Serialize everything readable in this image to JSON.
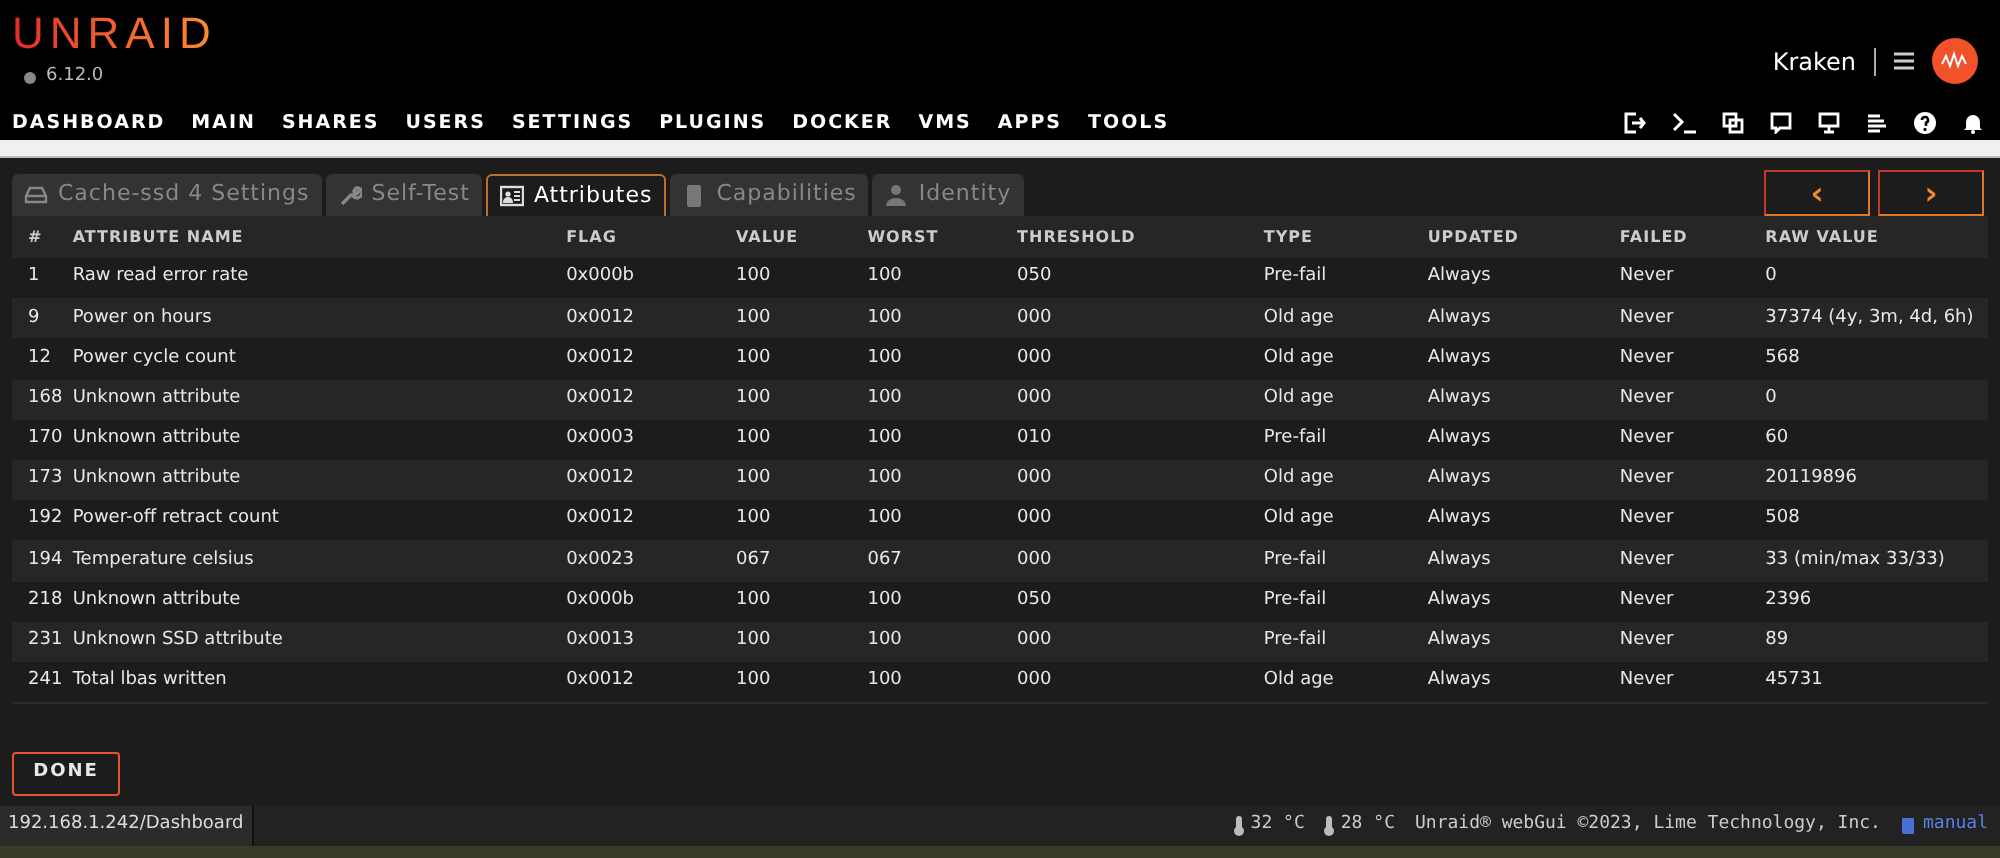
{
  "logo": "UNRAID",
  "version": "6.12.0",
  "server_name": "Kraken",
  "nav": [
    "DASHBOARD",
    "MAIN",
    "SHARES",
    "USERS",
    "SETTINGS",
    "PLUGINS",
    "DOCKER",
    "VMS",
    "APPS",
    "TOOLS"
  ],
  "tabs": [
    {
      "label": "Cache-ssd 4 Settings",
      "selected": false
    },
    {
      "label": "Self-Test",
      "selected": false
    },
    {
      "label": "Attributes",
      "selected": true
    },
    {
      "label": "Capabilities",
      "selected": false
    },
    {
      "label": "Identity",
      "selected": false
    }
  ],
  "pager": [
    "‹",
    "›"
  ],
  "table": {
    "columns": [
      "#",
      "ATTRIBUTE NAME",
      "FLAG",
      "VALUE",
      "WORST",
      "THRESHOLD",
      "TYPE",
      "UPDATED",
      "FAILED",
      "RAW VALUE"
    ],
    "rows": [
      [
        "1",
        "Raw read error rate",
        "0x000b",
        "100",
        "100",
        "050",
        "Pre-fail",
        "Always",
        "Never",
        "0"
      ],
      [
        "9",
        "Power on hours",
        "0x0012",
        "100",
        "100",
        "000",
        "Old age",
        "Always",
        "Never",
        "37374 (4y, 3m, 4d, 6h)"
      ],
      [
        "12",
        "Power cycle count",
        "0x0012",
        "100",
        "100",
        "000",
        "Old age",
        "Always",
        "Never",
        "568"
      ],
      [
        "168",
        "Unknown attribute",
        "0x0012",
        "100",
        "100",
        "000",
        "Old age",
        "Always",
        "Never",
        "0"
      ],
      [
        "170",
        "Unknown attribute",
        "0x0003",
        "100",
        "100",
        "010",
        "Pre-fail",
        "Always",
        "Never",
        "60"
      ],
      [
        "173",
        "Unknown attribute",
        "0x0012",
        "100",
        "100",
        "000",
        "Old age",
        "Always",
        "Never",
        "20119896"
      ],
      [
        "192",
        "Power-off retract count",
        "0x0012",
        "100",
        "100",
        "000",
        "Old age",
        "Always",
        "Never",
        "508"
      ],
      [
        "194",
        "Temperature celsius",
        "0x0023",
        "067",
        "067",
        "000",
        "Pre-fail",
        "Always",
        "Never",
        "33 (min/max 33/33)"
      ],
      [
        "218",
        "Unknown attribute",
        "0x000b",
        "100",
        "100",
        "050",
        "Pre-fail",
        "Always",
        "Never",
        "2396"
      ],
      [
        "231",
        "Unknown SSD attribute",
        "0x0013",
        "100",
        "100",
        "000",
        "Pre-fail",
        "Always",
        "Never",
        "89"
      ],
      [
        "241",
        "Total lbas written",
        "0x0012",
        "100",
        "100",
        "000",
        "Old age",
        "Always",
        "Never",
        "45731"
      ]
    ]
  },
  "done_button": "DONE",
  "status_bar": {
    "url": "192.168.1.242/Dashboard",
    "temps": [
      "32 °C",
      "28 °C"
    ],
    "copyright": "Unraid® webGui ©2023, Lime Technology, Inc.",
    "manual": "manual"
  }
}
